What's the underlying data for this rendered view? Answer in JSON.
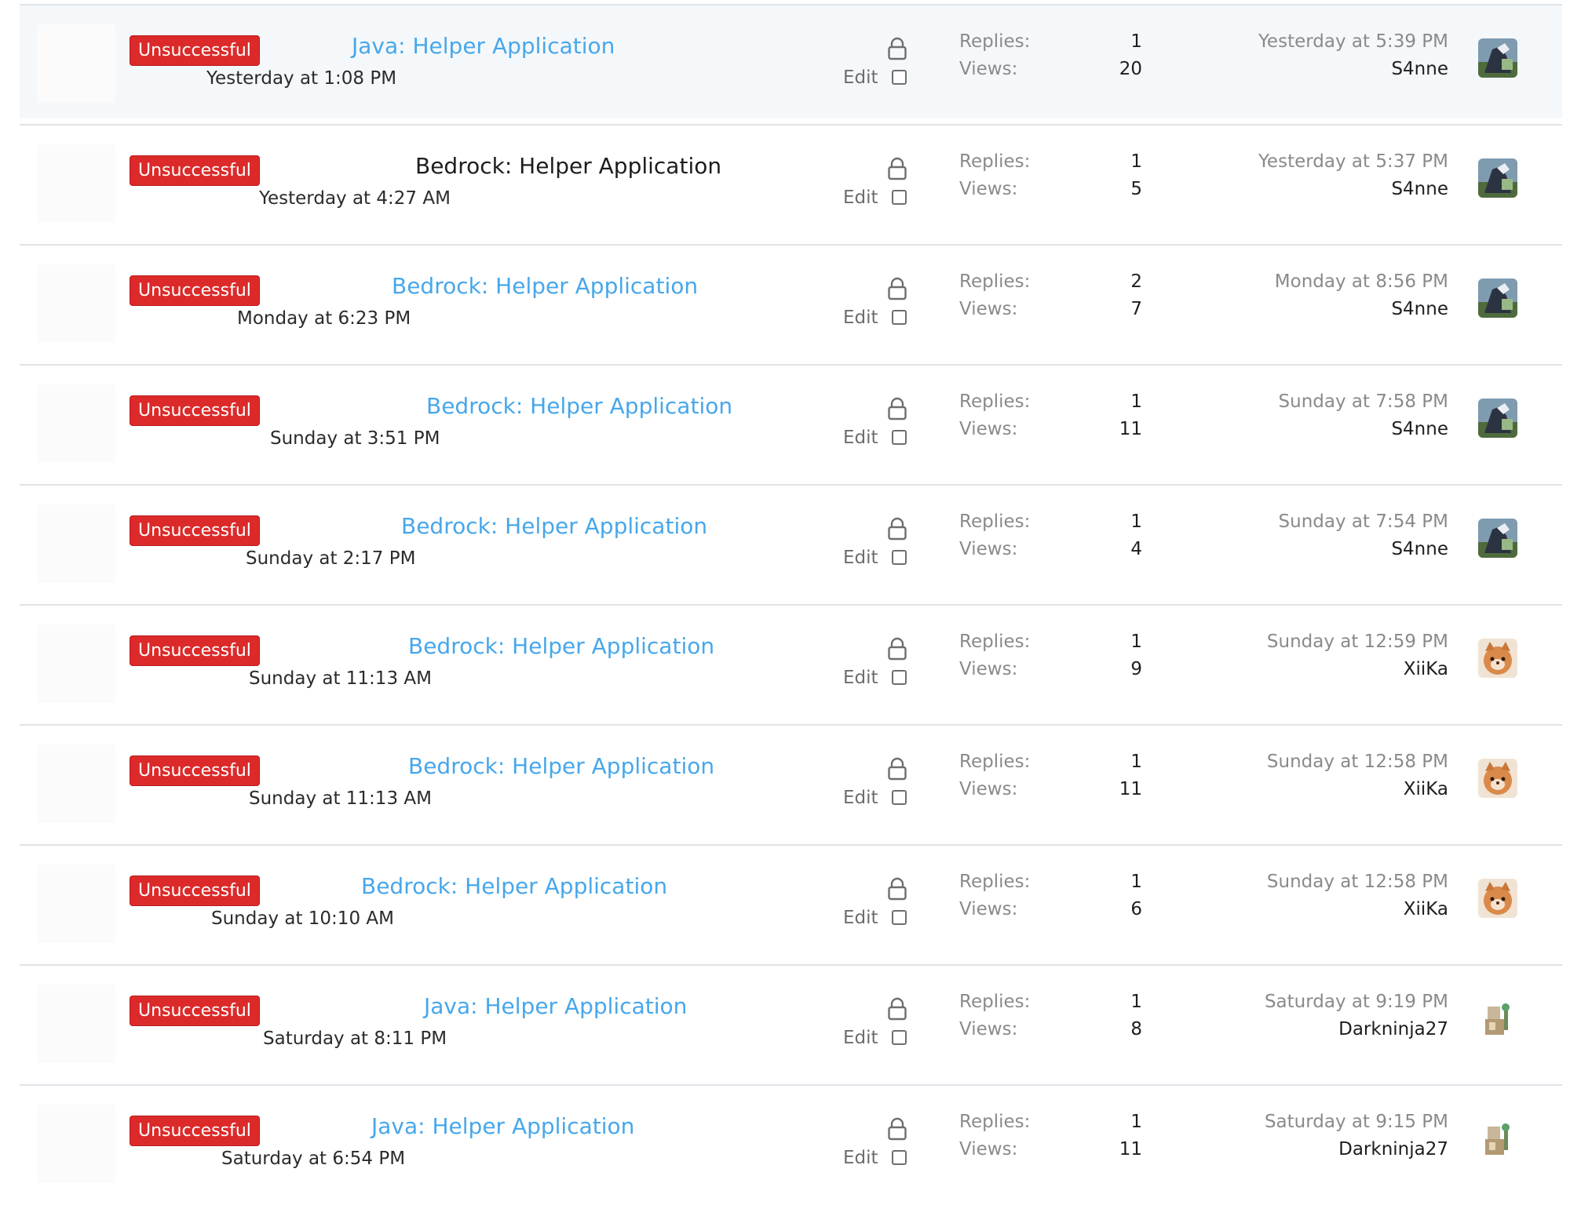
{
  "labels": {
    "replies": "Replies:",
    "views": "Views:",
    "edit": "Edit"
  },
  "colors": {
    "badge": "#dc2a2a",
    "link": "#47a7eb",
    "visited_title": "#1d1d1d",
    "meta": "#8a8a8a"
  },
  "threads": [
    {
      "prefix": "Unsuccessful",
      "title": "Java: Helper Application",
      "started": "Yesterday at 1:08 PM",
      "replies": "1",
      "views": "20",
      "last_post": "Yesterday at 5:39 PM",
      "last_user": "S4nne",
      "avatar_icon": "s4nne-avatar"
    },
    {
      "prefix": "Unsuccessful",
      "title": "Bedrock: Helper Application",
      "started": "Yesterday at 4:27 AM",
      "replies": "1",
      "views": "5",
      "last_post": "Yesterday at 5:37 PM",
      "last_user": "S4nne",
      "avatar_icon": "s4nne-avatar"
    },
    {
      "prefix": "Unsuccessful",
      "title": "Bedrock: Helper Application",
      "started": "Monday at 6:23 PM",
      "replies": "2",
      "views": "7",
      "last_post": "Monday at 8:56 PM",
      "last_user": "S4nne",
      "avatar_icon": "s4nne-avatar"
    },
    {
      "prefix": "Unsuccessful",
      "title": "Bedrock: Helper Application",
      "started": "Sunday at 3:51 PM",
      "replies": "1",
      "views": "11",
      "last_post": "Sunday at 7:58 PM",
      "last_user": "S4nne",
      "avatar_icon": "s4nne-avatar"
    },
    {
      "prefix": "Unsuccessful",
      "title": "Bedrock: Helper Application",
      "started": "Sunday at 2:17 PM",
      "replies": "1",
      "views": "4",
      "last_post": "Sunday at 7:54 PM",
      "last_user": "S4nne",
      "avatar_icon": "s4nne-avatar"
    },
    {
      "prefix": "Unsuccessful",
      "title": "Bedrock: Helper Application",
      "started": "Sunday at 11:13 AM",
      "replies": "1",
      "views": "9",
      "last_post": "Sunday at 12:59 PM",
      "last_user": "XiiKa",
      "avatar_icon": "xiika-avatar"
    },
    {
      "prefix": "Unsuccessful",
      "title": "Bedrock: Helper Application",
      "started": "Sunday at 11:13 AM",
      "replies": "1",
      "views": "11",
      "last_post": "Sunday at 12:58 PM",
      "last_user": "XiiKa",
      "avatar_icon": "xiika-avatar"
    },
    {
      "prefix": "Unsuccessful",
      "title": "Bedrock: Helper Application",
      "started": "Sunday at 10:10 AM",
      "replies": "1",
      "views": "6",
      "last_post": "Sunday at 12:58 PM",
      "last_user": "XiiKa",
      "avatar_icon": "xiika-avatar"
    },
    {
      "prefix": "Unsuccessful",
      "title": "Java: Helper Application",
      "started": "Saturday at 8:11 PM",
      "replies": "1",
      "views": "8",
      "last_post": "Saturday at 9:19 PM",
      "last_user": "Darkninja27",
      "avatar_icon": "darkninja27-avatar"
    },
    {
      "prefix": "Unsuccessful",
      "title": "Java: Helper Application",
      "started": "Saturday at 6:54 PM",
      "replies": "1",
      "views": "11",
      "last_post": "Saturday at 9:15 PM",
      "last_user": "Darkninja27",
      "avatar_icon": "darkninja27-avatar"
    }
  ]
}
